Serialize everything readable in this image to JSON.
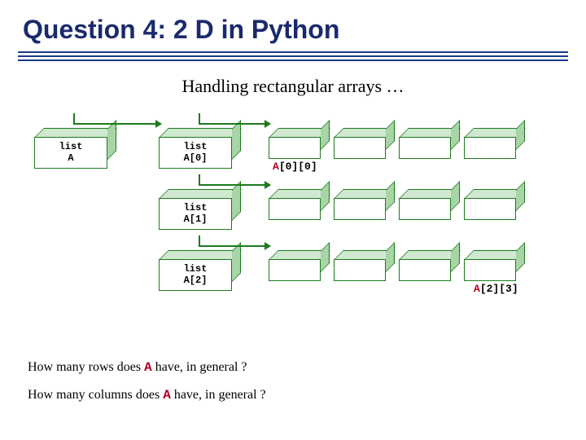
{
  "title_prefix": "Question 4",
  "title_rest": ": 2 D in Python",
  "subtitle": "Handling rectangular arrays …",
  "boxes": {
    "A": "list\nA",
    "A0": "list\nA[0]",
    "A1": "list\nA[1]",
    "A2": "list\nA[2]"
  },
  "annot": {
    "a00_pre": "A",
    "a00_post": "[0][0]",
    "a23_pre": "A",
    "a23_post": "[2][3]"
  },
  "q1_pre": "How many rows does ",
  "q1_a": "A",
  "q1_post": " have, in general ?",
  "q2_pre": "How many columns does ",
  "q2_a": "A",
  "q2_post": " have, in general ?"
}
